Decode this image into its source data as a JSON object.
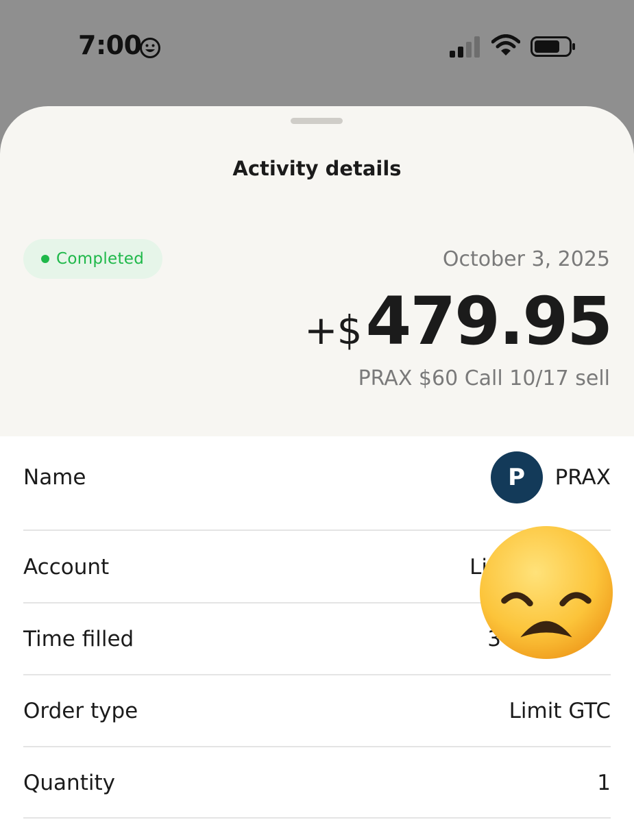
{
  "status_bar": {
    "time": "7:00",
    "icons": [
      "smiley-icon",
      "cellular-signal-icon",
      "wifi-icon",
      "battery-icon"
    ]
  },
  "sheet": {
    "title": "Activity details",
    "status": "Completed",
    "date": "October 3, 2025",
    "amount_prefix": "+$",
    "amount_value": "479.95",
    "subtitle": "PRAX $60 Call 10/17 sell"
  },
  "details": {
    "rows": [
      {
        "label": "Name",
        "value": "PRAX",
        "avatar_letter": "P"
      },
      {
        "label": "Account",
        "value": "Li"
      },
      {
        "label": "Time filled",
        "value": "3"
      },
      {
        "label": "Order type",
        "value": "Limit GTC"
      },
      {
        "label": "Quantity",
        "value": "1"
      }
    ]
  },
  "overlay": {
    "icon": "sad-face-emoji"
  },
  "colors": {
    "status_green": "#1fb84a",
    "badge_bg": "#e6f5e9",
    "avatar_bg": "#133a59",
    "sheet_bg": "#f7f6f2",
    "status_bar_bg": "#8f8f8f"
  }
}
